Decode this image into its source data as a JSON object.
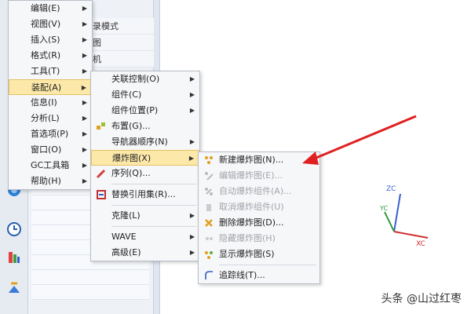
{
  "main_menu": {
    "items": [
      {
        "label": "编辑(E)",
        "has_submenu": true
      },
      {
        "label": "视图(V)",
        "has_submenu": true
      },
      {
        "label": "插入(S)",
        "has_submenu": true
      },
      {
        "label": "格式(R)",
        "has_submenu": true
      },
      {
        "label": "工具(T)",
        "has_submenu": true
      },
      {
        "label": "装配(A)",
        "has_submenu": true,
        "selected": true
      },
      {
        "label": "信息(I)",
        "has_submenu": true
      },
      {
        "label": "分析(L)",
        "has_submenu": true
      },
      {
        "label": "首选项(P)",
        "has_submenu": true
      },
      {
        "label": "窗口(O)",
        "has_submenu": true
      },
      {
        "label": "GC工具箱",
        "has_submenu": true
      },
      {
        "label": "帮助(H)",
        "has_submenu": true
      }
    ]
  },
  "assembly_menu": {
    "items": [
      {
        "label": "关联控制(O)",
        "has_submenu": true
      },
      {
        "label": "组件(C)",
        "has_submenu": true
      },
      {
        "label": "组件位置(P)",
        "has_submenu": true
      },
      {
        "label": "布置(G)...",
        "icon": "layout-icon"
      },
      {
        "label": "导航器顺序(N)",
        "has_submenu": true
      },
      {
        "label": "爆炸图(X)",
        "has_submenu": true,
        "selected": true
      },
      {
        "label": "序列(Q)...",
        "icon": "sequence-icon"
      },
      {
        "label": "替换引用集(R)...",
        "icon": "replace-refset-icon"
      },
      {
        "label": "克隆(L)",
        "has_submenu": true
      },
      {
        "label": "WAVE",
        "has_submenu": true
      },
      {
        "label": "高级(E)",
        "has_submenu": true
      }
    ]
  },
  "exploded_view_menu": {
    "items": [
      {
        "label": "新建爆炸图(N)...",
        "icon": "new-explosion-icon",
        "enabled": true
      },
      {
        "label": "编辑爆炸图(E)...",
        "icon": "edit-explosion-icon",
        "enabled": false
      },
      {
        "label": "自动爆炸组件(A)...",
        "icon": "auto-explode-icon",
        "enabled": false
      },
      {
        "label": "取消爆炸组件(U)",
        "icon": "unexplode-icon",
        "enabled": false
      },
      {
        "label": "删除爆炸图(D)...",
        "icon": "delete-explosion-icon",
        "enabled": true
      },
      {
        "label": "隐藏爆炸图(H)",
        "icon": "hide-explosion-icon",
        "enabled": false
      },
      {
        "label": "显示爆炸图(S)",
        "icon": "show-explosion-icon",
        "enabled": true
      },
      {
        "label": "追踪线(T)...",
        "icon": "tracelines-icon",
        "enabled": true
      }
    ]
  },
  "panel_partial": {
    "items": [
      "录模式",
      "图",
      "机"
    ]
  },
  "axes": {
    "zc": "ZC",
    "yc": "YC",
    "xc": "XC",
    "colors": {
      "z": "#3a5fd0",
      "y": "#2a9a3a",
      "x": "#d03030"
    }
  },
  "watermark": "头条 @山过红枣",
  "colors": {
    "selected_bg": "#fce8a8",
    "arrow": "#e02020"
  }
}
